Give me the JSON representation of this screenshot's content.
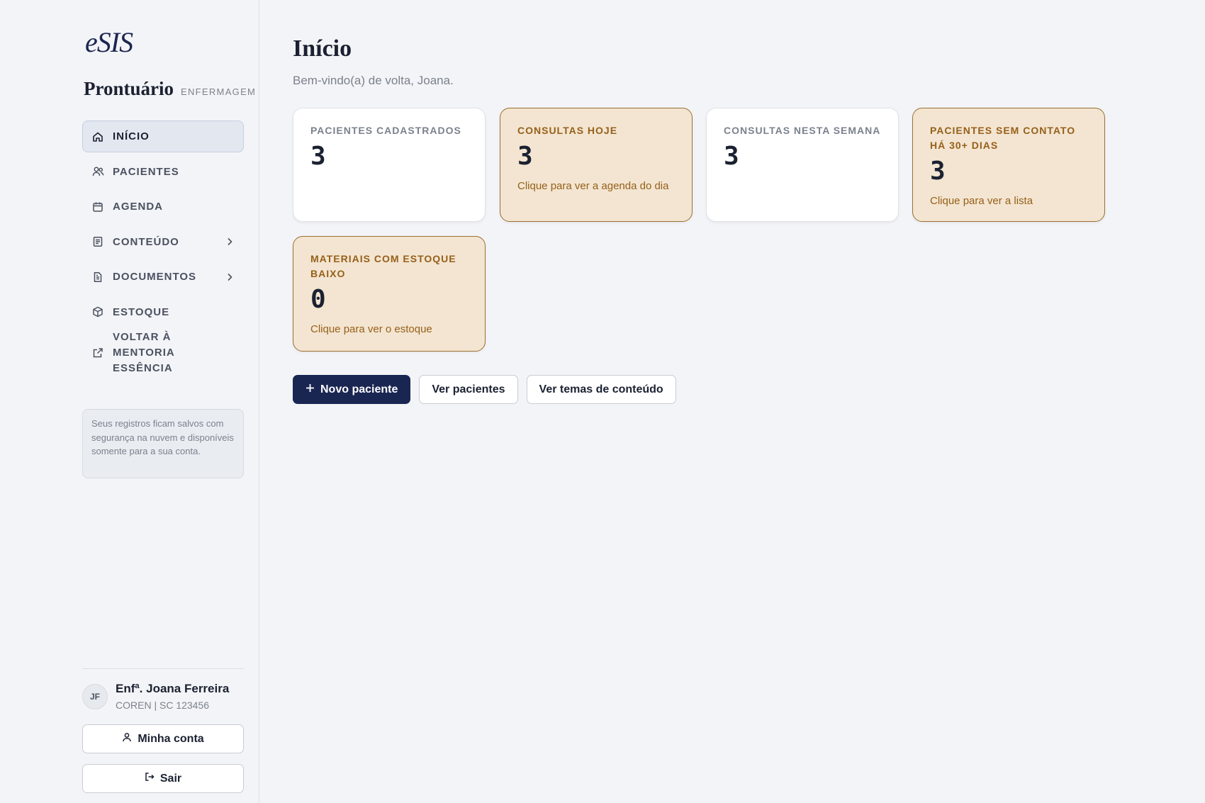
{
  "sidebar": {
    "logo": "eSIS",
    "brand_title": "Prontuário",
    "brand_subtitle": "ENFERMAGEM",
    "items": [
      {
        "label": "INÍCIO",
        "icon": "home-icon",
        "active": true
      },
      {
        "label": "PACIENTES",
        "icon": "users-icon"
      },
      {
        "label": "AGENDA",
        "icon": "calendar-icon"
      },
      {
        "label": "CONTEÚDO",
        "icon": "document-icon",
        "has_submenu": true
      },
      {
        "label": "DOCUMENTOS",
        "icon": "file-icon",
        "has_submenu": true
      },
      {
        "label": "ESTOQUE",
        "icon": "box-icon"
      },
      {
        "label": "VOLTAR À MENTORIA ESSÊNCIA",
        "icon": "external-link-icon"
      }
    ],
    "notice": "Seus registros ficam salvos com segurança na nuvem e disponíveis somente para a sua conta.",
    "user": {
      "initials": "JF",
      "name": "Enfª. Joana Ferreira",
      "registration": "COREN | SC 123456"
    },
    "account_button": "Minha conta",
    "logout_button": "Sair"
  },
  "main": {
    "title": "Início",
    "welcome": "Bem-vindo(a) de volta, Joana.",
    "cards": [
      {
        "label": "PACIENTES CADASTRADOS",
        "value": "3",
        "hint": "",
        "style": "plain"
      },
      {
        "label": "CONSULTAS HOJE",
        "value": "3",
        "hint": "Clique para ver a agenda do dia",
        "style": "warn"
      },
      {
        "label": "CONSULTAS NESTA SEMANA",
        "value": "3",
        "hint": "",
        "style": "plain"
      },
      {
        "label": "PACIENTES SEM CONTATO HÁ 30+ DIAS",
        "value": "3",
        "hint": "Clique para ver a lista",
        "style": "warn"
      },
      {
        "label": "MATERIAIS COM ESTOQUE BAIXO",
        "value": "0",
        "hint": "Clique para ver o estoque",
        "style": "warn"
      }
    ],
    "actions": {
      "new_patient": "Novo paciente",
      "view_patients": "Ver pacientes",
      "view_topics": "Ver temas de conteúdo"
    }
  },
  "colors": {
    "primary": "#1a2652",
    "warn_bg": "#f3e5d1",
    "warn_border": "#9a7033",
    "warn_text": "#96601a"
  }
}
